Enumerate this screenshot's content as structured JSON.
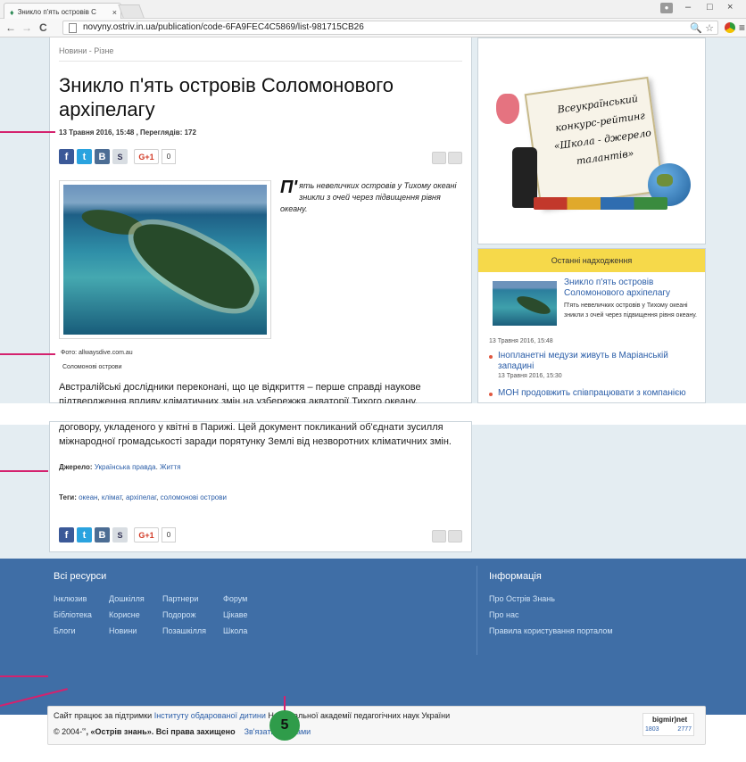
{
  "browser": {
    "tab_title": "Зникло п'ять островів С",
    "tab_close": "×",
    "url": "novyny.ostriv.in.ua/publication/code-6FA9FEC4C5869/list-981715CB26",
    "back": "←",
    "forward": "→",
    "reload": "C",
    "zoom_icon": "🔍",
    "star_icon": "☆",
    "menu_icon": "≡",
    "min": "–",
    "max": "□",
    "close": "×"
  },
  "article": {
    "breadcrumb": "Новини - Різне",
    "title": "Зникло п'ять островів Соломонового архіпелагу",
    "meta": "13 Травня 2016, 15:48 , Переглядів: 172",
    "share": {
      "fb": "f",
      "tw": "t",
      "vk": "B",
      "sk": "S",
      "gplus": "G+1",
      "count": "0"
    },
    "lead_dropcap": "П'",
    "lead_rest": "ять невеличких островів у Тихому океані зникли з очей через підвищення рівня океану.",
    "photo_credit": "Фото: allwaysdive.com.au",
    "photo_caption": "Соломонові острови",
    "body_top": "Австралійські дослідники переконані, що це відкриття – перше справді наукове підтвердження впливу кліматичних змін на узбережжя акваторії Тихого океану, повідомляє The Guardian.",
    "body_bottom": "договору, укладеного у квітні в Парижі. Цей документ покликаний об'єднати зусилля міжнародної громадськості заради порятунку Землі від незворотних кліматичних змін.",
    "source_label": "Джерело:",
    "source_links": [
      "Українська правда",
      "Життя"
    ],
    "tags_label": "Теги:",
    "tags": [
      "океан",
      "клімат",
      "архіпелаг",
      "соломонові острови"
    ]
  },
  "promo": {
    "text": "Всеукраїнський конкурс-рейтинг «Школа - джерело талантів»"
  },
  "recent": {
    "heading": "Останні надходження",
    "first_title": "Зникло п'ять островів Соломонового архіпелагу",
    "first_desc": "П'ять невеличких островів у Тихому океані зникли з очей через підвищення рівня океану.",
    "first_date": "13 Травня 2016, 15:48",
    "items": [
      {
        "title": "Інопланетні медузи живуть в Маріанській западині",
        "date": "13 Травня 2016, 15:30"
      },
      {
        "title": "МОН продовжить співпрацювати з компанією",
        "date": ""
      }
    ]
  },
  "footer": {
    "resources_heading": "Всі ресурси",
    "resources": [
      [
        "Інклюзив",
        "Дошкілля",
        "Партнери",
        "Форум"
      ],
      [
        "Бібліотека",
        "Корисне",
        "Подорож",
        "Цікаве"
      ],
      [
        "Блоги",
        "Новини",
        "Позашкілля",
        "Школа"
      ]
    ],
    "info_heading": "Інформація",
    "info_links": [
      "Про Острів Знань",
      "Про нас",
      "Правила користування порталом"
    ],
    "support_prefix": "Сайт працює за підтримки ",
    "support_link": "Інституту обдарованої дитини",
    "support_suffix": " Національної академії педагогічних наук України",
    "copyright_prefix": "© 2004-",
    "copyright_sup": "∞",
    "copyright_mid": ", «Острів знань». Всі права захищено",
    "contact_link": "Зв'язатися з нами",
    "counter_title": "bigmir)net",
    "counter_a": "1803",
    "counter_b": "2777"
  },
  "annotation": {
    "badge": "5"
  },
  "colors": {
    "accent_pink": "#d4226e",
    "footer_blue": "#3f6ea6",
    "recent_yellow": "#f6d94a",
    "badge_green": "#2f9c4a"
  }
}
